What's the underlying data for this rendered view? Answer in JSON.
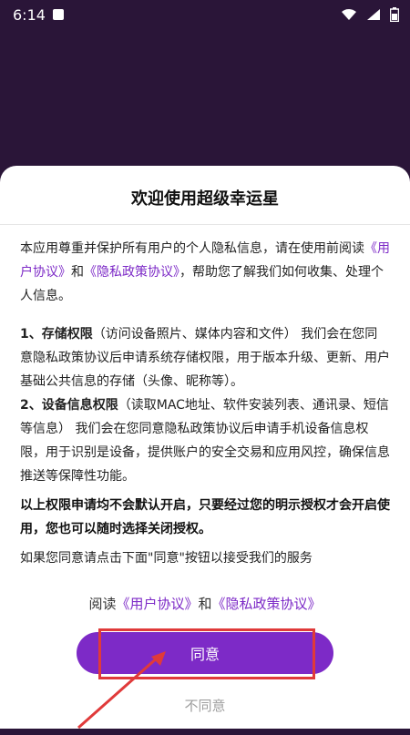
{
  "status_bar": {
    "time": "6:14"
  },
  "dialog": {
    "title": "欢迎使用超级幸运星",
    "intro": {
      "part1": "本应用尊重并保护所有用户的个人隐私信息，请在使用前阅读",
      "user_agreement_link": "《用户协议》",
      "and": "和",
      "privacy_policy_link": "《隐私政策协议》",
      "part2": "，帮助您了解我们如何收集、处理个人信息。"
    },
    "permissions": [
      {
        "title": "1、存储权限",
        "detail": "（访问设备照片、媒体内容和文件） 我们会在您同意隐私政策协议后申请系统存储权限，用于版本升级、更新、用户基础公共信息的存储（头像、昵称等）。"
      },
      {
        "title": "2、设备信息权限",
        "detail": "（读取MAC地址、软件安装列表、通讯录、短信等信息） 我们会在您同意隐私政策协议后申请手机设备信息权限，用于识别是设备，提供账户的安全交易和应用风控，确保信息推送等保障性功能。"
      }
    ],
    "notice": "以上权限申请均不会默认开启，只要经过您的明示授权才会开启使用，您也可以随时选择关闭授权。",
    "closing": "如果您同意请点击下面\"同意\"按钮以接受我们的服务",
    "read_line": {
      "prefix": "阅读",
      "user_agreement_link": "《用户协议》",
      "and": "和",
      "privacy_policy_link": "《隐私政策协议》"
    },
    "agree_label": "同意",
    "disagree_label": "不同意"
  },
  "colors": {
    "background": "#2a1538",
    "accent": "#7d2ac7",
    "annotation": "#e03a3a"
  }
}
